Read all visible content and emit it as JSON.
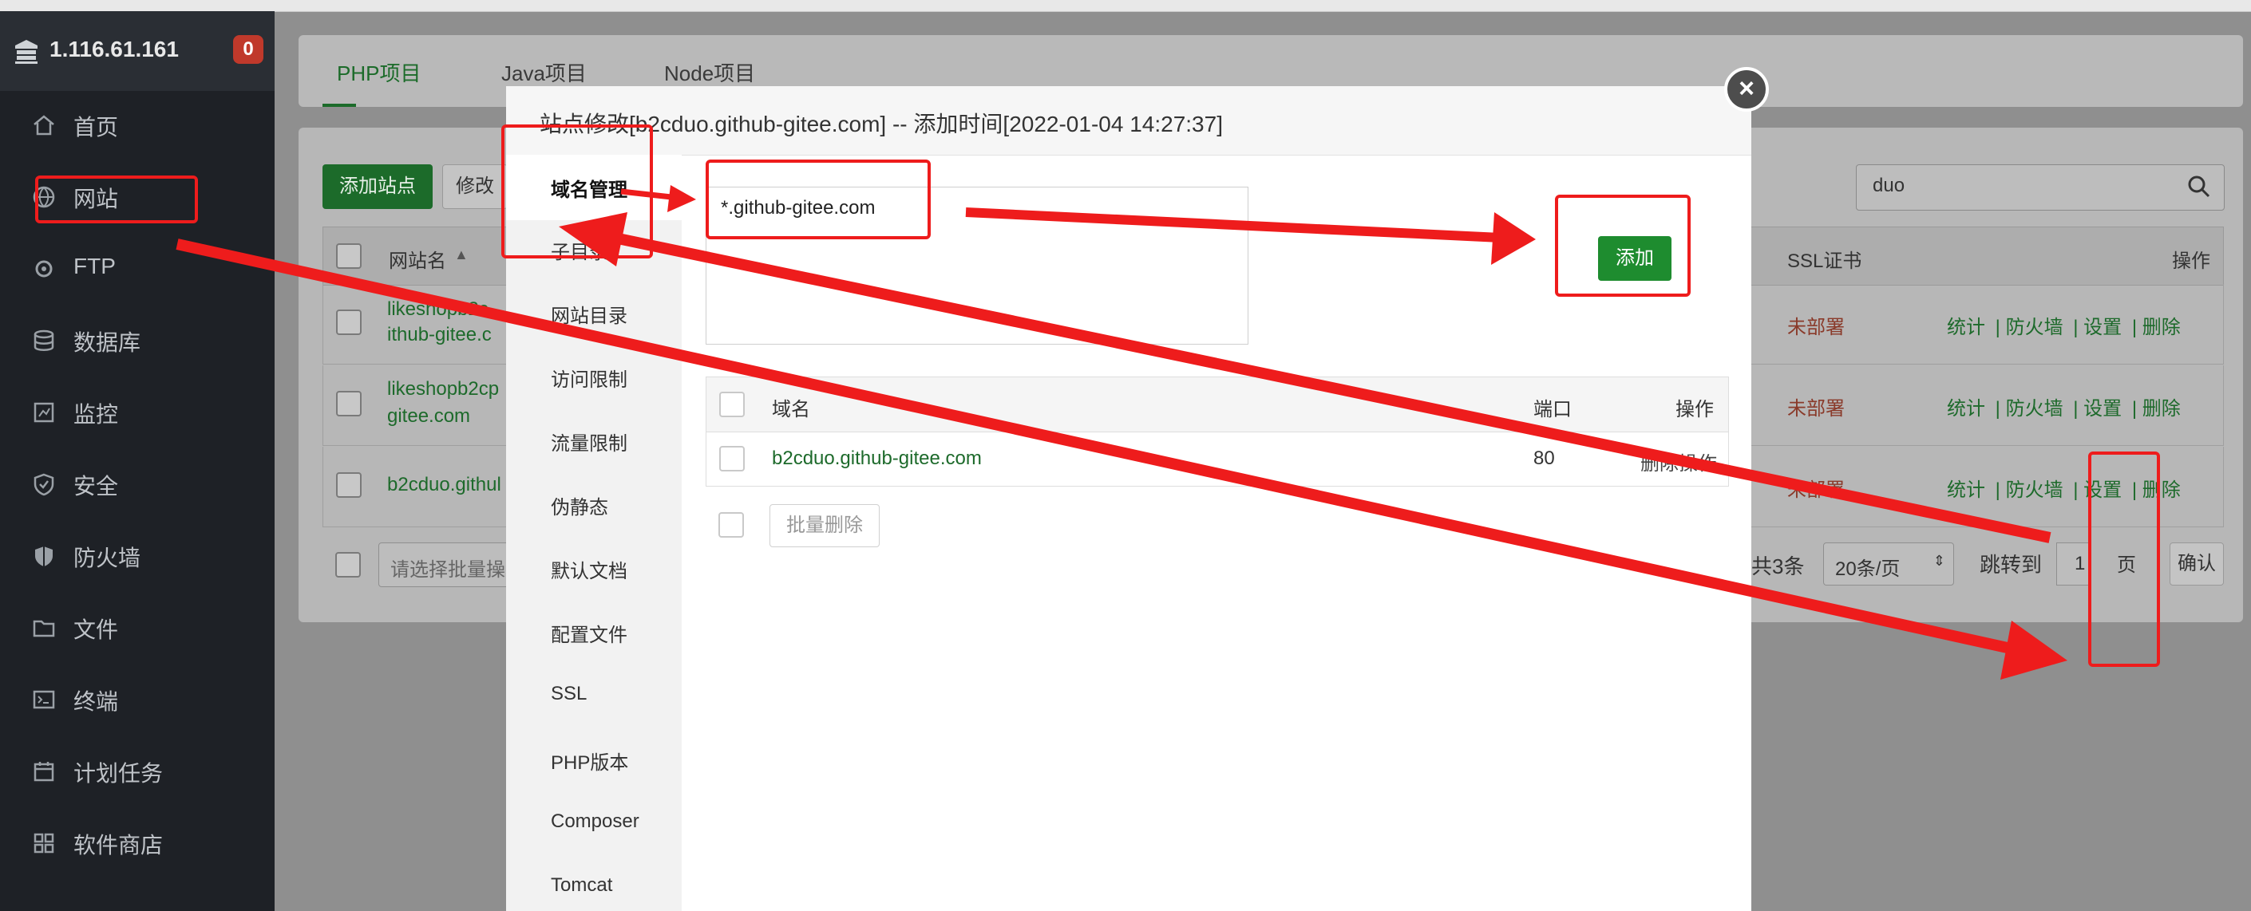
{
  "server": {
    "ip": "1.116.61.161",
    "alert_count": "0"
  },
  "sidebar": {
    "items": [
      {
        "label": "首页",
        "icon": "home-icon"
      },
      {
        "label": "网站",
        "icon": "globe-icon"
      },
      {
        "label": "FTP",
        "icon": "ftp-icon"
      },
      {
        "label": "数据库",
        "icon": "database-icon"
      },
      {
        "label": "监控",
        "icon": "monitor-icon"
      },
      {
        "label": "安全",
        "icon": "shield-icon"
      },
      {
        "label": "防火墙",
        "icon": "firewall-icon"
      },
      {
        "label": "文件",
        "icon": "folder-icon"
      },
      {
        "label": "终端",
        "icon": "terminal-icon"
      },
      {
        "label": "计划任务",
        "icon": "calendar-icon"
      },
      {
        "label": "软件商店",
        "icon": "apps-icon"
      }
    ]
  },
  "tabs": [
    "PHP项目",
    "Java项目",
    "Node项目"
  ],
  "toolbar": {
    "add_site": "添加站点",
    "modify": "修改",
    "search_value": "duo"
  },
  "site_table": {
    "headers": {
      "name": "网站名",
      "ssl": "SSL证书",
      "ops": "操作"
    },
    "rows": [
      {
        "name_line1": "likeshopb2c",
        "name_line2": "ithub-gitee.c",
        "ssl": "未部署"
      },
      {
        "name_line1": "likeshopb2cp",
        "name_line2": "gitee.com",
        "ssl": "未部署"
      },
      {
        "name_line1": "b2cduo.githul",
        "name_line2": "",
        "ssl": "未部署"
      }
    ],
    "row_ops": [
      "统计",
      "防火墙",
      "设置",
      "删除"
    ],
    "batch_placeholder": "请选择批量操",
    "total": "共3条",
    "per_page": "20条/页",
    "goto_label": "跳转到",
    "goto_page": "1",
    "page_unit": "页",
    "confirm": "确认"
  },
  "modal": {
    "title": "站点修改[b2cduo.github-gitee.com] -- 添加时间[2022-01-04 14:27:37]",
    "menu": [
      "域名管理",
      "子目录",
      "网站目录",
      "访问限制",
      "流量限制",
      "伪静态",
      "默认文档",
      "配置文件",
      "SSL",
      "PHP版本",
      "Composer",
      "Tomcat"
    ],
    "domain_input": "*.github-gitee.com",
    "add_button": "添加",
    "table_headers": {
      "domain": "域名",
      "port": "端口",
      "ops": "操作"
    },
    "domains": [
      {
        "domain": "b2cduo.github-gitee.com",
        "port": "80",
        "op": "删除操作"
      }
    ],
    "bulk_delete": "批量删除",
    "close_symbol": "×"
  },
  "colors": {
    "annotation": "#ee1c1c",
    "accent_green": "#1e8c2f",
    "sidebar_bg": "#1e2126"
  }
}
